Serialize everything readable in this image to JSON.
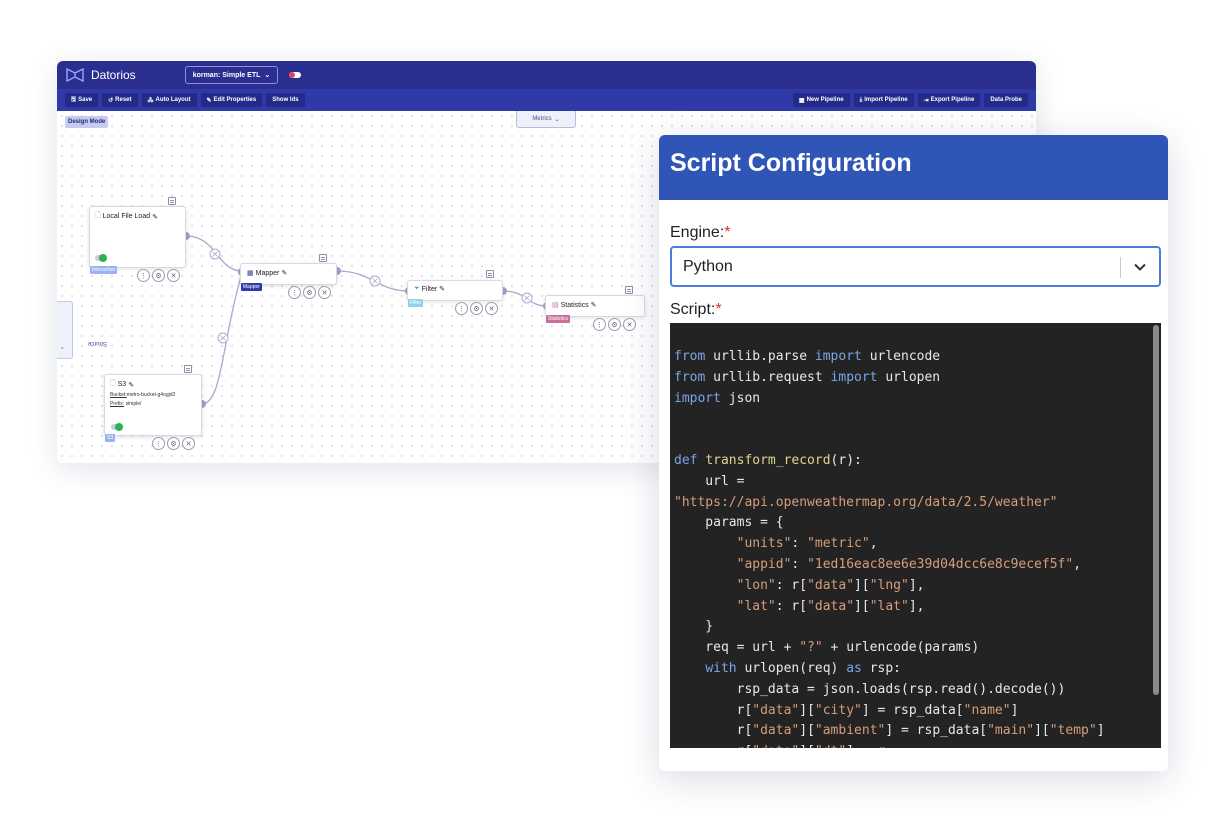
{
  "app": {
    "brand": "Datorios",
    "pipeline_select": "korman: Simple ETL",
    "toolbar_left": [
      "Save",
      "Reset",
      "Auto Layout",
      "Edit Properties",
      "Show Ids"
    ],
    "toolbar_right": [
      "New Pipeline",
      "Import Pipeline",
      "Export Pipeline",
      "Data Probe"
    ],
    "design_mode": "Design Mode",
    "metrics": "Metrics",
    "source_tab": "Source"
  },
  "nodes": {
    "local_file": {
      "title": "Local File Load",
      "tag": "Interactive"
    },
    "mapper": {
      "title": "Mapper",
      "tag": "Mapper"
    },
    "filter": {
      "title": "Filter",
      "tag": "Filter"
    },
    "statistics": {
      "title": "Statistics",
      "tag": "Statistics"
    },
    "s3": {
      "title": "S3",
      "bucket_label": "Bucket:",
      "bucket_value": "metro-bucket-g4ogjd2",
      "prefix_label": "Prefix:",
      "prefix_value": "simple/",
      "tag": "S3"
    }
  },
  "modal": {
    "title": "Script Configuration",
    "engine_label": "Engine:",
    "required_mark": "*",
    "engine_value": "Python",
    "script_label": "Script:",
    "code_lines": [
      [
        [
          "kw",
          "from "
        ],
        [
          "pl",
          "urllib.parse "
        ],
        [
          "kw",
          "import "
        ],
        [
          "pl",
          "urlencode"
        ]
      ],
      [
        [
          "kw",
          "from "
        ],
        [
          "pl",
          "urllib.request "
        ],
        [
          "kw",
          "import "
        ],
        [
          "pl",
          "urlopen"
        ]
      ],
      [
        [
          "kw",
          "import "
        ],
        [
          "pl",
          "json"
        ]
      ],
      [],
      [],
      [
        [
          "kw",
          "def "
        ],
        [
          "fn",
          "transform_record"
        ],
        [
          "pl",
          "(r):"
        ]
      ],
      [
        [
          "pl",
          "    url ="
        ]
      ],
      [
        [
          "st",
          "\"https://api.openweathermap.org/data/2.5/weather\""
        ]
      ],
      [
        [
          "pl",
          "    params = {"
        ]
      ],
      [
        [
          "pl",
          "        "
        ],
        [
          "st",
          "\"units\""
        ],
        [
          "pl",
          ": "
        ],
        [
          "st",
          "\"metric\""
        ],
        [
          "pl",
          ","
        ]
      ],
      [
        [
          "pl",
          "        "
        ],
        [
          "st",
          "\"appid\""
        ],
        [
          "pl",
          ": "
        ],
        [
          "st",
          "\"1ed16eac8ee6e39d04dcc6e8c9ecef5f\""
        ],
        [
          "pl",
          ","
        ]
      ],
      [
        [
          "pl",
          "        "
        ],
        [
          "st",
          "\"lon\""
        ],
        [
          "pl",
          ": r["
        ],
        [
          "st",
          "\"data\""
        ],
        [
          "pl",
          "]["
        ],
        [
          "st",
          "\"lng\""
        ],
        [
          "pl",
          "],"
        ]
      ],
      [
        [
          "pl",
          "        "
        ],
        [
          "st",
          "\"lat\""
        ],
        [
          "pl",
          ": r["
        ],
        [
          "st",
          "\"data\""
        ],
        [
          "pl",
          "]["
        ],
        [
          "st",
          "\"lat\""
        ],
        [
          "pl",
          "],"
        ]
      ],
      [
        [
          "pl",
          "    }"
        ]
      ],
      [
        [
          "pl",
          "    req = url + "
        ],
        [
          "st",
          "\"?\""
        ],
        [
          "pl",
          " + urlencode(params)"
        ]
      ],
      [
        [
          "pl",
          "    "
        ],
        [
          "kw",
          "with "
        ],
        [
          "pl",
          "urlopen(req) "
        ],
        [
          "kw",
          "as "
        ],
        [
          "pl",
          "rsp:"
        ]
      ],
      [
        [
          "pl",
          "        rsp_data = json.loads(rsp.read().decode())"
        ]
      ],
      [
        [
          "pl",
          "        r["
        ],
        [
          "st",
          "\"data\""
        ],
        [
          "pl",
          "]["
        ],
        [
          "st",
          "\"city\""
        ],
        [
          "pl",
          "] = rsp_data["
        ],
        [
          "st",
          "\"name\""
        ],
        [
          "pl",
          "]"
        ]
      ],
      [
        [
          "pl",
          "        r["
        ],
        [
          "st",
          "\"data\""
        ],
        [
          "pl",
          "]["
        ],
        [
          "st",
          "\"ambient\""
        ],
        [
          "pl",
          "] = rsp_data["
        ],
        [
          "st",
          "\"main\""
        ],
        [
          "pl",
          "]["
        ],
        [
          "st",
          "\"temp\""
        ],
        [
          "pl",
          "]"
        ]
      ],
      [
        [
          "pl",
          "        r["
        ],
        [
          "st",
          "\"data\""
        ],
        [
          "pl",
          "]["
        ],
        [
          "st",
          "\"dt\""
        ],
        [
          "pl",
          "] = r"
        ]
      ]
    ]
  },
  "colors": {
    "topbar": "#2a2f8f",
    "toolbar": "#2f3aa8",
    "modal_header": "#2f55b6",
    "editor_bg": "#232323",
    "tag_interactive": "#9bb2f0",
    "tag_mapper": "#2f3aa8",
    "tag_filter": "#8fd3ea",
    "tag_statistics": "#c9709a",
    "tag_s3": "#9bb2f0"
  }
}
